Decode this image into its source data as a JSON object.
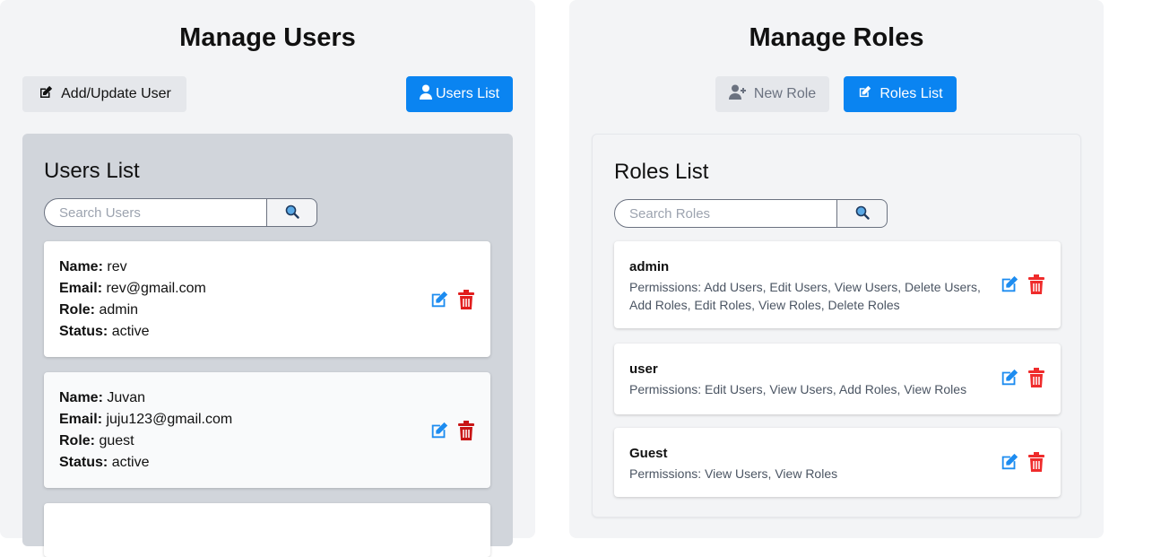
{
  "users_panel": {
    "title": "Manage Users",
    "add_button": "Add/Update User",
    "list_button": "Users List",
    "list_title": "Users List",
    "search_placeholder": "Search Users",
    "field_labels": {
      "name": "Name:",
      "email": "Email:",
      "role": "Role:",
      "status": "Status:"
    },
    "users": [
      {
        "name": "rev",
        "email": "rev@gmail.com",
        "role": "admin",
        "status": "active"
      },
      {
        "name": "Juvan",
        "email": "juju123@gmail.com",
        "role": "guest",
        "status": "active"
      }
    ]
  },
  "roles_panel": {
    "title": "Manage Roles",
    "new_button": "New Role",
    "list_button": "Roles List",
    "list_title": "Roles List",
    "search_placeholder": "Search Roles",
    "roles": [
      {
        "name": "admin",
        "permissions": "Permissions: Add Users, Edit Users, View Users, Delete Users, Add Roles, Edit Roles, View Roles, Delete Roles"
      },
      {
        "name": "user",
        "permissions": "Permissions: Edit Users, View Users, Add Roles, View Roles"
      },
      {
        "name": "Guest",
        "permissions": "Permissions: View Users, View Roles"
      }
    ]
  },
  "colors": {
    "primary": "#0a84f1",
    "edit": "#1d8cf0",
    "delete": "#e11d1d",
    "panel": "#f3f4f6",
    "users_card": "#d1d5db"
  },
  "icons": [
    "edit-square-icon",
    "user-icon",
    "user-plus-icon",
    "search-icon",
    "trash-icon"
  ]
}
